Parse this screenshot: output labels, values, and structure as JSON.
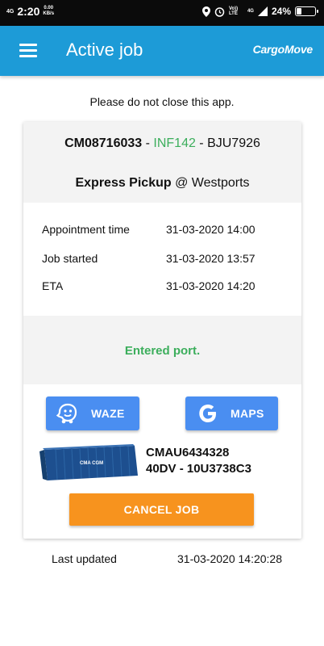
{
  "status_bar": {
    "network_left": "4G",
    "time": "2:20",
    "speed_value": "0.00",
    "speed_unit": "KB/s",
    "volte": "Vo)) LTE",
    "network_right": "4G",
    "battery": "24%",
    "battery_level": 0.24
  },
  "app_bar": {
    "title": "Active job",
    "brand": "CargoMove",
    "menu_icon": "hamburger-icon",
    "color": "#1d9bd7"
  },
  "notice": "Please do not close this app.",
  "job": {
    "id": "CM08716033",
    "sep1": " - ",
    "ref": "INF142",
    "sep2": " - ",
    "plate": "BJU7926",
    "type": "Express Pickup",
    "at": " @ ",
    "location": "Westports"
  },
  "details": [
    {
      "label": "Appointment time",
      "value": "31-03-2020 14:00"
    },
    {
      "label": "Job started",
      "value": "31-03-2020 13:57"
    },
    {
      "label": "ETA",
      "value": "31-03-2020 14:20"
    }
  ],
  "status": {
    "text": "Entered port.",
    "color": "#3cae5c"
  },
  "buttons": {
    "waze": "WAZE",
    "maps": "MAPS",
    "cancel": "CANCEL JOB",
    "nav_color": "#4a8ef1",
    "cancel_color": "#f7931e"
  },
  "container": {
    "number": "CMAU6434328",
    "spec": "40DV - 10U3738C3",
    "image_label": "CMA CGM"
  },
  "last_updated": {
    "label": "Last updated",
    "value": "31-03-2020 14:20:28"
  }
}
